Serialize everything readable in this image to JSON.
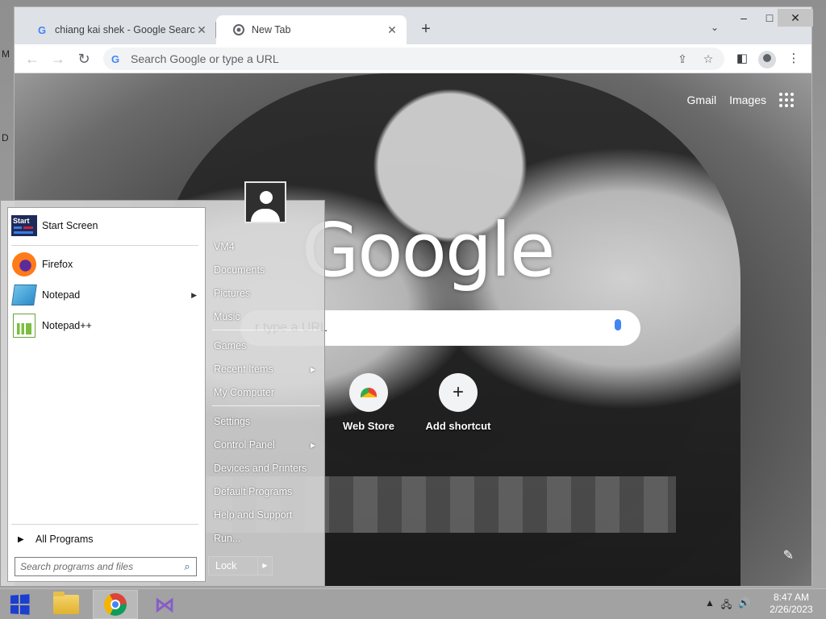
{
  "desktop": {
    "left_letters": [
      "M",
      "D"
    ]
  },
  "browser": {
    "tabs": [
      {
        "label": "chiang kai shek - Google Search",
        "icon": "google-g-icon",
        "active": false
      },
      {
        "label": "New Tab",
        "icon": "chrome-icon",
        "active": true
      }
    ],
    "new_tab_symbol": "+",
    "omnibox_placeholder": "Search Google or type a URL"
  },
  "ntp": {
    "links": [
      "Gmail",
      "Images"
    ],
    "logo": "Google",
    "search_placeholder": "r type a URL",
    "shortcuts": [
      {
        "label": "Web Store",
        "icon": "webstore-icon"
      },
      {
        "label": "Add shortcut",
        "icon": "plus-icon"
      }
    ]
  },
  "start_menu": {
    "pinned": [
      {
        "label": "Start Screen",
        "icon": "start-screen-icon"
      },
      {
        "label": "Firefox",
        "icon": "firefox-icon"
      },
      {
        "label": "Notepad",
        "icon": "notepad-icon",
        "has_submenu": true
      },
      {
        "label": "Notepad++",
        "icon": "notepad-plus-plus-icon"
      }
    ],
    "start_icon_text": "Start",
    "all_programs": "All Programs",
    "search_placeholder": "Search programs and files",
    "right_items": [
      {
        "label": "VM4"
      },
      {
        "label": "Documents"
      },
      {
        "label": "Pictures"
      },
      {
        "label": "Music"
      },
      {
        "label": "Games"
      },
      {
        "label": "Recent Items",
        "has_submenu": true
      },
      {
        "label": "My Computer"
      },
      {
        "label": "Settings"
      },
      {
        "label": "Control Panel",
        "has_submenu": true
      },
      {
        "label": "Devices and Printers"
      },
      {
        "label": "Default Programs"
      },
      {
        "label": "Help and Support"
      },
      {
        "label": "Run..."
      }
    ],
    "lock_label": "Lock"
  },
  "taskbar": {
    "apps": [
      {
        "name": "file-explorer",
        "active": false
      },
      {
        "name": "google-chrome",
        "active": true
      },
      {
        "name": "visual-studio",
        "active": false
      }
    ],
    "time": "8:47 AM",
    "date": "2/26/2023"
  }
}
